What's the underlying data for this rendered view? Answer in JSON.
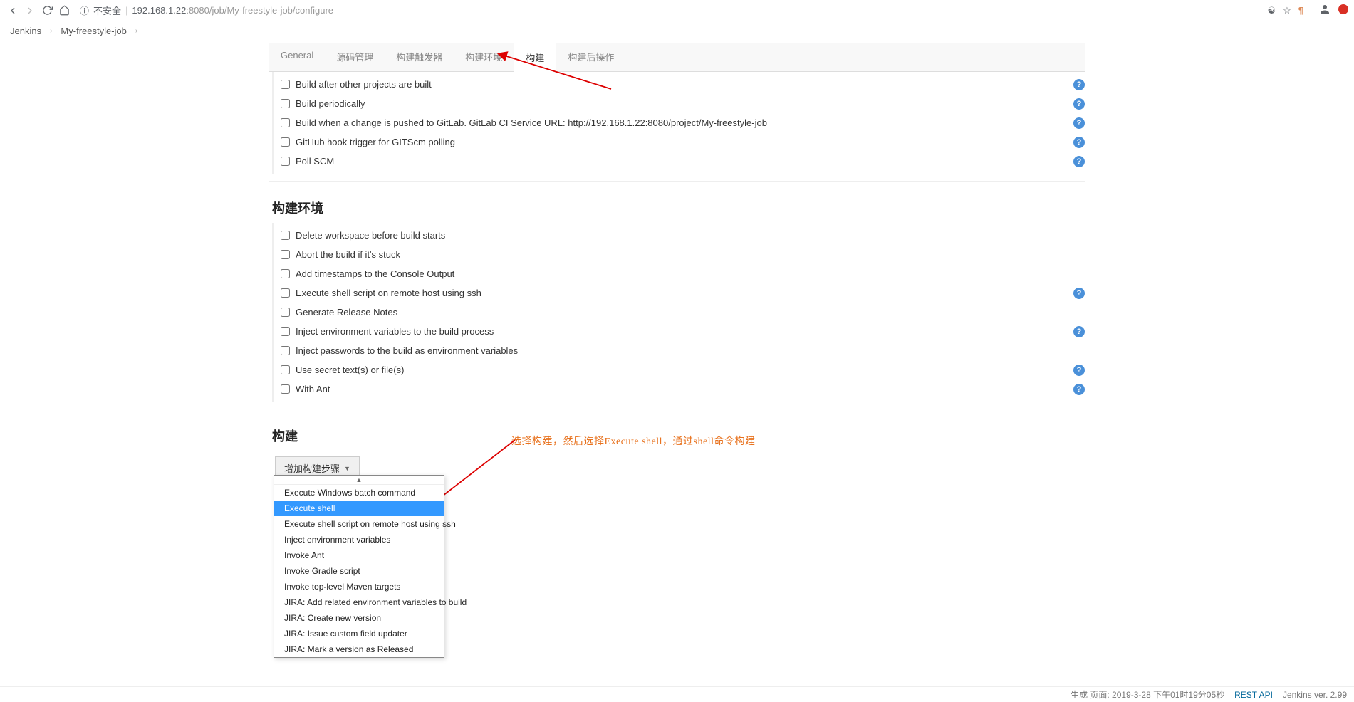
{
  "browser": {
    "insecure_label": "不安全",
    "url_host": "192.168.1.22",
    "url_port": ":8080",
    "url_path": "/job/My-freestyle-job/configure"
  },
  "breadcrumb": {
    "root": "Jenkins",
    "job": "My-freestyle-job"
  },
  "tabs": {
    "general": "General",
    "scm": "源码管理",
    "trigger": "构建触发器",
    "env": "构建环境",
    "build": "构建",
    "post": "构建后操作"
  },
  "triggers": {
    "build_after": "Build after other projects are built",
    "periodically": "Build periodically",
    "gitlab_push": "Build when a change is pushed to GitLab. GitLab CI Service URL: http://192.168.1.22:8080/project/My-freestyle-job",
    "github_hook": "GitHub hook trigger for GITScm polling",
    "poll_scm": "Poll SCM"
  },
  "env_section": {
    "title": "构建环境",
    "delete_ws": "Delete workspace before build starts",
    "abort_stuck": "Abort the build if it's stuck",
    "timestamps": "Add timestamps to the Console Output",
    "exec_ssh": "Execute shell script on remote host using ssh",
    "release_notes": "Generate Release Notes",
    "inject_env": "Inject environment variables to the build process",
    "inject_pwd": "Inject passwords to the build as environment variables",
    "secret": "Use secret text(s) or file(s)",
    "with_ant": "With Ant"
  },
  "build_section": {
    "title": "构建",
    "add_step": "增加构建步骤"
  },
  "dropdown": {
    "items": [
      "Execute Windows batch command",
      "Execute shell",
      "Execute shell script on remote host using ssh",
      "Inject environment variables",
      "Invoke Ant",
      "Invoke Gradle script",
      "Invoke top-level Maven targets",
      "JIRA: Add related environment variables to build",
      "JIRA: Create new version",
      "JIRA: Issue custom field updater",
      "JIRA: Mark a version as Released"
    ],
    "selected_index": 1
  },
  "annotation": {
    "text": "选择构建，然后选择Execute shell，通过shell命令构建"
  },
  "footer": {
    "gen": "生成 页面: 2019-3-28 下午01时19分05秒",
    "rest": "REST API",
    "ver": "Jenkins ver. 2.99"
  }
}
